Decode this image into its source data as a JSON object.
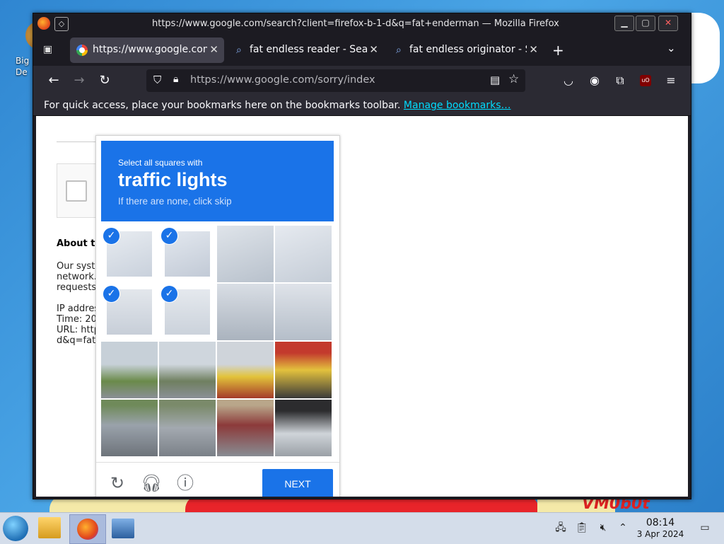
{
  "window": {
    "title": "https://www.google.com/search?client=firefox-b-1-d&q=fat+enderman — Mozilla Firefox"
  },
  "tabs": [
    {
      "label": "https://www.google.com/",
      "icon": "google-favicon",
      "active": true
    },
    {
      "label": "fat endless reader - Sear",
      "icon": "search-icon",
      "active": false
    },
    {
      "label": "fat endless originator - S",
      "icon": "search-icon",
      "active": false
    }
  ],
  "urlbar": {
    "value": "https://www.google.com/sorry/index"
  },
  "bookmarks_bar": {
    "text": "For quick access, place your bookmarks here on the bookmarks toolbar.",
    "link": "Manage bookmarks…"
  },
  "sorry_page": {
    "heading": "About th",
    "lines": [
      "Our syste",
      "network.",
      "requests",
      "IP addres",
      "Time: 20",
      "URL: http",
      "d&q=fat+"
    ]
  },
  "captcha": {
    "select_label": "Select all squares with",
    "object": "traffic lights",
    "skip_hint": "If there are none, click skip",
    "next_label": "NEXT",
    "selected_tiles": [
      0,
      1,
      4,
      5
    ],
    "accent": "#1a73e8"
  },
  "desktop": {
    "icon_label": "Big\nDe",
    "wallpaper_text": "VM0b0t"
  },
  "taskbar": {
    "time": "08:14",
    "date": "3 Apr 2024"
  }
}
